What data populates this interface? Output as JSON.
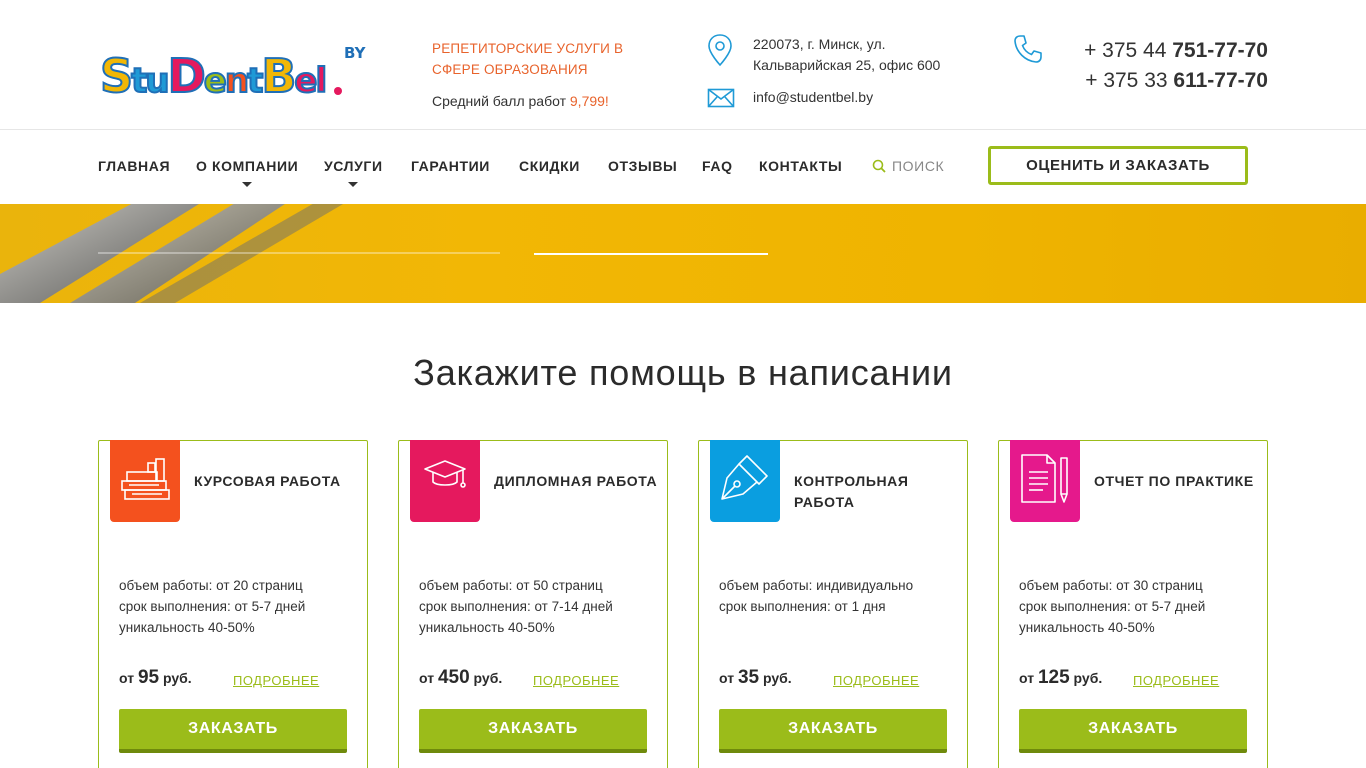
{
  "header": {
    "logo_text": "StuDentBel",
    "logo_suffix": "BY",
    "tagline": "РЕПЕТИТОРСКИЕ УСЛУГИ В СФЕРЕ ОБРАЗОВАНИЯ",
    "avg_label": "Средний балл работ",
    "avg_value": "9,799!",
    "address_line1": "220073, г. Минск, ул.",
    "address_line2": "Кальварийская 25, офис 600",
    "email": "info@studentbel.by",
    "phone1_prefix": "+ 375 44",
    "phone1_number": "751-77-70",
    "phone2_prefix": "+ 375 33",
    "phone2_number": "611-77-70"
  },
  "nav": {
    "items": [
      {
        "label": "ГЛАВНАЯ"
      },
      {
        "label": "О КОМПАНИИ"
      },
      {
        "label": "УСЛУГИ"
      },
      {
        "label": "ГАРАНТИИ"
      },
      {
        "label": "СКИДКИ"
      },
      {
        "label": "ОТЗЫВЫ"
      },
      {
        "label": "FAQ"
      },
      {
        "label": "КОНТАКТЫ"
      }
    ],
    "search_label": "ПОИСК",
    "order_button": "ОЦЕНИТЬ И ЗАКАЗАТЬ"
  },
  "section": {
    "title": "Закажите помощь в написании"
  },
  "cards": [
    {
      "title": "КУРСОВАЯ РАБОТА",
      "icon": "books-icon",
      "color": "#f4511e",
      "desc": [
        "объем работы: от 20 страниц",
        "срок выполнения: от 5-7 дней",
        "уникальность 40-50%"
      ],
      "price_from": "от",
      "price": "95",
      "currency": "руб.",
      "more": "ПОДРОБНЕЕ",
      "button": "ЗАКАЗАТЬ"
    },
    {
      "title": "ДИПЛОМНАЯ РАБОТА",
      "icon": "graduation-cap-icon",
      "color": "#e5195e",
      "desc": [
        "объем работы: от 50 страниц",
        "срок выполнения: от 7-14 дней",
        "уникальность 40-50%"
      ],
      "price_from": "от",
      "price": "450",
      "currency": "руб.",
      "more": "ПОДРОБНЕЕ",
      "button": "ЗАКАЗАТЬ"
    },
    {
      "title": "КОНТРОЛЬНАЯ РАБОТА",
      "icon": "pen-nib-icon",
      "color": "#0a9ee0",
      "desc": [
        "объем работы: индивидуально",
        "срок выполнения: от 1 дня"
      ],
      "price_from": "от",
      "price": "35",
      "currency": "руб.",
      "more": "ПОДРОБНЕЕ",
      "button": "ЗАКАЗАТЬ"
    },
    {
      "title": "ОТЧЕТ ПО ПРАКТИКЕ",
      "icon": "document-pencil-icon",
      "color": "#e5198c",
      "desc": [
        "объем работы: от 30 страниц",
        "срок выполнения: от 5-7 дней",
        "уникальность 40-50%"
      ],
      "price_from": "от",
      "price": "125",
      "currency": "руб.",
      "more": "ПОДРОБНЕЕ",
      "button": "ЗАКАЗАТЬ"
    }
  ]
}
